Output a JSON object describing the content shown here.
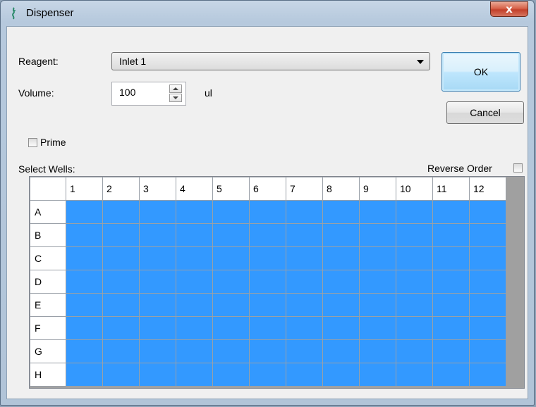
{
  "window": {
    "title": "Dispenser",
    "close_label": "x"
  },
  "reagent": {
    "label": "Reagent:",
    "value": "Inlet 1"
  },
  "volume": {
    "label": "Volume:",
    "value": "100",
    "unit": "ul"
  },
  "buttons": {
    "ok": "OK",
    "cancel": "Cancel"
  },
  "prime": {
    "label": "Prime",
    "checked": false
  },
  "select_wells": {
    "label": "Select Wells:"
  },
  "reverse_order": {
    "label": "Reverse Order",
    "checked": false
  },
  "plate": {
    "columns": [
      "1",
      "2",
      "3",
      "4",
      "5",
      "6",
      "7",
      "8",
      "9",
      "10",
      "11",
      "12"
    ],
    "rows": [
      "A",
      "B",
      "C",
      "D",
      "E",
      "F",
      "G",
      "H"
    ],
    "selected_color": "#3399ff",
    "all_selected": true
  }
}
